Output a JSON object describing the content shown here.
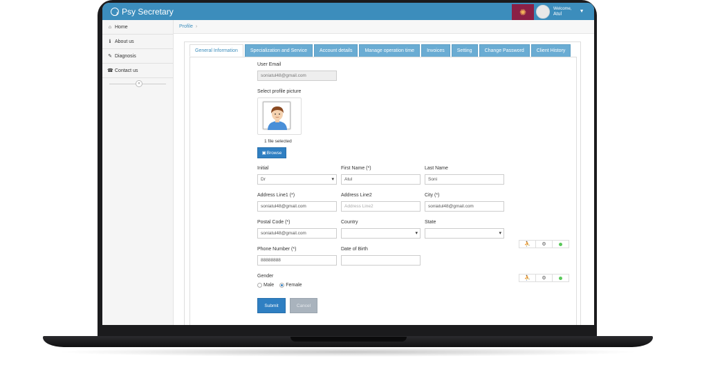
{
  "app": {
    "title": "Psy Secretary"
  },
  "user": {
    "welcome": "Welcome,",
    "name": "Atul"
  },
  "sidebar": {
    "items": [
      {
        "icon": "home-icon",
        "glyph": "⌂",
        "label": "Home"
      },
      {
        "icon": "info-icon",
        "glyph": "ℹ",
        "label": "About us"
      },
      {
        "icon": "edit-icon",
        "glyph": "✎",
        "label": "Diagnosis"
      },
      {
        "icon": "phone-icon",
        "glyph": "☎",
        "label": "Contact us"
      }
    ],
    "collapse_glyph": "«"
  },
  "breadcrumb": {
    "current": "Profile",
    "sep": "›"
  },
  "tabs": [
    {
      "label": "General Information",
      "active": true
    },
    {
      "label": "Specialization and Service"
    },
    {
      "label": "Account details"
    },
    {
      "label": "Manage operation time"
    },
    {
      "label": "Invoices"
    },
    {
      "label": "Setting"
    },
    {
      "label": "Change Password"
    },
    {
      "label": "Client History"
    }
  ],
  "form": {
    "user_email": {
      "label": "User Email",
      "value": "soniatul48@gmail.com"
    },
    "profile_picture": {
      "label": "Select profile picture",
      "file_status": "1 file selected",
      "browse_label": "Browse"
    },
    "initial": {
      "label": "Initial",
      "value": "Dr"
    },
    "first_name": {
      "label": "First Name (*)",
      "value": "Atul"
    },
    "last_name": {
      "label": "Last Name",
      "value": "Soni"
    },
    "address_line1": {
      "label": "Address Line1 (*)",
      "value": "soniatul48@gmail.com"
    },
    "address_line2": {
      "label": "Address Line2",
      "placeholder": "Address Line2"
    },
    "city": {
      "label": "City (*)",
      "value": "soniatul48@gmail.com"
    },
    "postal_code": {
      "label": "Postal Code (*)",
      "value": "soniatul48@gmail.com"
    },
    "country": {
      "label": "Country",
      "value": ""
    },
    "state": {
      "label": "State",
      "value": ""
    },
    "phone_number": {
      "label": "Phone Number (*)",
      "value": "88888888"
    },
    "date_of_birth": {
      "label": "Date of Birth",
      "value": ""
    },
    "gender": {
      "label": "Gender",
      "options": [
        "Male",
        "Female"
      ],
      "selected": "Female"
    },
    "submit_label": "Submit",
    "cancel_label": "Cancel"
  },
  "colors": {
    "header": "#3c8dbc",
    "tab": "#6aacd3",
    "notif": "#8a2046",
    "status_dot": "#5ac85a"
  }
}
